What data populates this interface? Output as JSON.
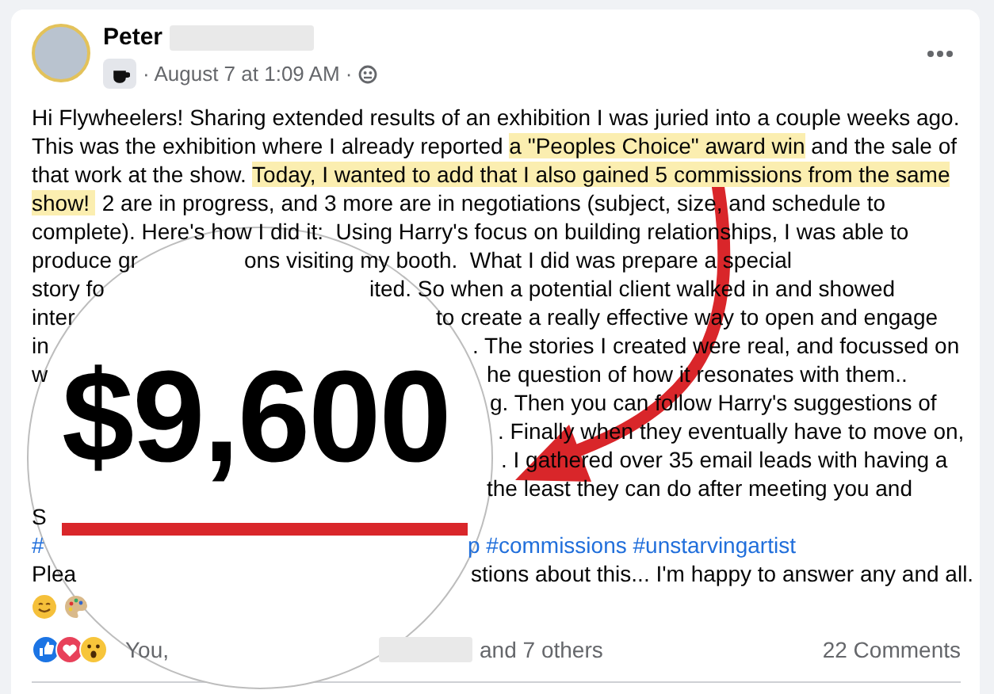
{
  "post": {
    "author": "Peter",
    "time": "· August 7 at 1:09 AM ·",
    "lines": [
      {
        "left": [
          {
            "kind": "plain",
            "text": "Hi Flywheelers! Sharing extended results of an exhibition I was juried into a couple weeks ago."
          }
        ]
      },
      {
        "left": [
          {
            "kind": "plain",
            "text": "This was the exhibition where I already reported "
          },
          {
            "kind": "highlight",
            "text": "a \"Peoples Choice\" award win"
          },
          {
            "kind": "plain",
            "text": " and the sale of"
          }
        ]
      },
      {
        "left": [
          {
            "kind": "plain",
            "text": "that work at the show. "
          },
          {
            "kind": "highlight",
            "text": "Today, I wanted to add that I also gained 5 commissions from the same"
          }
        ]
      },
      {
        "left": [
          {
            "kind": "highlight",
            "text": "show! "
          },
          {
            "kind": "plain",
            "text": " 2 are in progress, and 3 more are in negotiations (subject, size, and schedule to"
          }
        ]
      },
      {
        "left": [
          {
            "kind": "plain",
            "text": "complete). Here's how I did it:  Using Harry's focus on building relationships, I was able to"
          }
        ]
      },
      {
        "left": [
          {
            "kind": "plain",
            "text": "produce gr"
          }
        ],
        "right": [
          {
            "kind": "plain",
            "text": "ons visiting my booth.  What I did was prepare a special"
          }
        ]
      },
      {
        "left": [
          {
            "kind": "plain",
            "text": "story fo"
          }
        ],
        "right": [
          {
            "kind": "plain",
            "text": "ited. So when a potential client walked in and showed"
          }
        ]
      },
      {
        "left": [
          {
            "kind": "plain",
            "text": "inter"
          }
        ],
        "right": [
          {
            "kind": "plain",
            "text": "to create a really effective way to open and engage"
          }
        ]
      },
      {
        "left": [
          {
            "kind": "plain",
            "text": "in"
          }
        ],
        "right": [
          {
            "kind": "plain",
            "text": ". The stories I created were real, and focussed on"
          }
        ]
      },
      {
        "left": [
          {
            "kind": "plain",
            "text": "w"
          }
        ],
        "right": [
          {
            "kind": "plain",
            "text": "he question of how it resonates with them.."
          }
        ]
      },
      {
        "right": [
          {
            "kind": "plain",
            "text": "g. Then you can follow Harry's suggestions of"
          }
        ]
      },
      {
        "right": [
          {
            "kind": "plain",
            "text": ". Finally when they eventually have to move on,"
          }
        ]
      },
      {
        "right": [
          {
            "kind": "plain",
            "text": ". I gathered over 35 email leads with having a"
          }
        ]
      },
      {
        "right": [
          {
            "kind": "plain",
            "text": "the least they can do after meeting you and"
          }
        ]
      },
      {
        "left": [
          {
            "kind": "plain",
            "text": "S"
          }
        ]
      },
      {
        "left": [
          {
            "kind": "hashtag",
            "text": "#"
          }
        ],
        "right": [
          {
            "kind": "hashtag",
            "text": "p #commissions #unstarvingartist"
          }
        ]
      },
      {
        "left": [
          {
            "kind": "plain",
            "text": "Plea"
          }
        ],
        "right": [
          {
            "kind": "plain",
            "text": "stions about this... I'm happy to answer any and all."
          }
        ]
      }
    ],
    "reactions": {
      "start": "You,",
      "end": "and 7 others"
    },
    "comments": "22 Comments"
  },
  "overlay": {
    "amount": "$9,600"
  }
}
